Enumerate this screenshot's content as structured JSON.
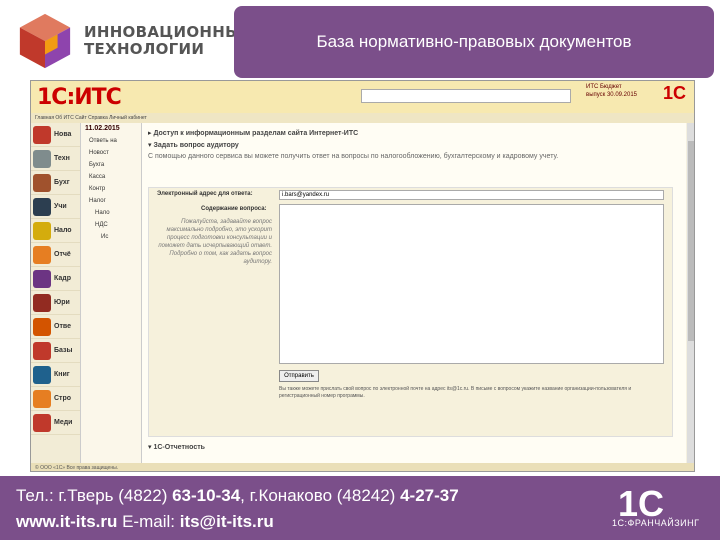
{
  "brand": {
    "line1": "ИННОВАЦИОННЫЕ",
    "line2": "ТЕХНОЛОГИИ"
  },
  "header": {
    "title": "База нормативно-правовых документов"
  },
  "app": {
    "logo_text": "1С:ИТС",
    "search_placeholder": "",
    "its_info": "ИТС Бюджет\nвыпуск 30.09.2015",
    "menu": "Главная  Об ИТС  Сайт  Справка  Личный кабинет",
    "left_items": [
      "Нова",
      "Техн",
      "Бухг",
      "Учи",
      "Нало",
      "Отчё",
      "Кадр",
      "Юри",
      "Отве",
      "Базы",
      "Книг",
      "Стро",
      "Меди"
    ],
    "tree": {
      "date": "11.02.2015",
      "items": [
        "Ответь на",
        "Новост",
        "Бухга",
        "Касса",
        "Контр",
        "Налог",
        "Нало",
        "НДС",
        "Ис"
      ]
    },
    "content": {
      "section1": "Доступ к информационным разделам сайта Интернет-ИТС",
      "section2": "Задать вопрос аудитору",
      "section2_desc": "С помощью данного сервиса вы можете получить ответ на вопросы по налогообложению, бухгалтерскому и кадровому учету.",
      "email_label": "Электронный адрес для ответа:",
      "email_value": "i.bars@yandex.ru",
      "question_label": "Содержание вопроса:",
      "hint": "Пожалуйста, задавайте вопрос максимально подробно, это ускорит процесс подготовки консультации и поможет дать исчерпывающий ответ. Подробно о том, как задать вопрос аудитору.",
      "send_button": "Отправить",
      "note": "Вы также можете прислать свой вопрос по электронной почте на адрес its@1c.ru. В письме с вопросом укажите название организации-пользователя и регистрационный номер программы.",
      "section3": "1С-Отчетность"
    },
    "footer": "© ООО «1С» Все права защищены."
  },
  "contact": {
    "line1_prefix": "Тел.: г.Тверь (4822) ",
    "line1_num1": "63-10-34",
    "line1_mid": ", г.Конаково (48242) ",
    "line1_num2": "4-27-37",
    "site": "www.it-its.ru",
    "email_prefix": "  E-mail: ",
    "email": "its@it-its.ru",
    "franchise": "1С:ФРАНЧАЙЗИНГ",
    "logo": "1С"
  }
}
